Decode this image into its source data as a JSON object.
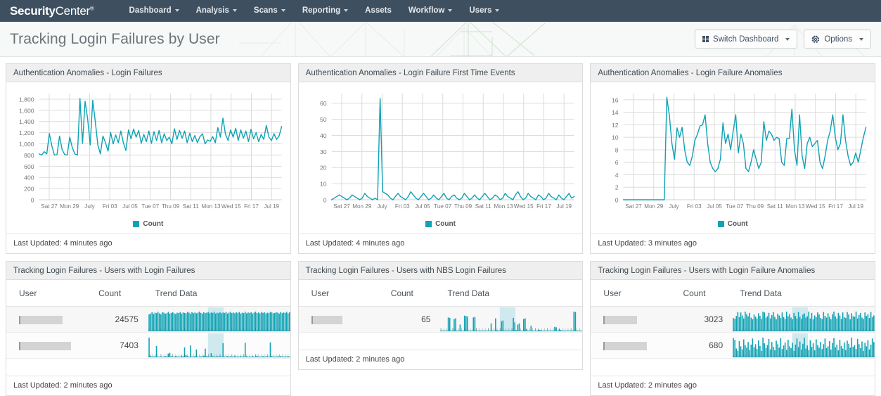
{
  "navbar": {
    "brand_bold": "Security",
    "brand_light": "Center",
    "brand_tm": "®",
    "items": [
      {
        "label": "Dashboard",
        "caret": true,
        "name": "nav-dashboard"
      },
      {
        "label": "Analysis",
        "caret": true,
        "name": "nav-analysis"
      },
      {
        "label": "Scans",
        "caret": true,
        "name": "nav-scans"
      },
      {
        "label": "Reporting",
        "caret": true,
        "name": "nav-reporting"
      },
      {
        "label": "Assets",
        "caret": false,
        "name": "nav-assets"
      },
      {
        "label": "Workflow",
        "caret": true,
        "name": "nav-workflow"
      },
      {
        "label": "Users",
        "caret": true,
        "name": "nav-users"
      }
    ]
  },
  "header": {
    "title": "Tracking Login Failures by User",
    "switch_dashboard_label": "Switch Dashboard",
    "options_label": "Options",
    "gear_icon": "gear-icon",
    "grid_icon": "grid-icon"
  },
  "colors": {
    "navbar": "#3e4f60",
    "teal": "#10a3b5",
    "teal_dark": "#0d92a4",
    "highlight": "#cfe9ef",
    "panel_head": "#efefef",
    "page_header": "#f7f8f8",
    "watermark_green": "#cfe3cb"
  },
  "legend_label": "Count",
  "table_headers": {
    "user": "User",
    "count": "Count",
    "trend": "Trend Data"
  },
  "panels": [
    {
      "name": "panel-login-failures",
      "title": "Authentication Anomalies - Login Failures",
      "footer": "Last Updated: 4 minutes ago"
    },
    {
      "name": "panel-login-failure-first-time-events",
      "title": "Authentication Anomalies - Login Failure First Time Events",
      "footer": "Last Updated: 4 minutes ago"
    },
    {
      "name": "panel-login-failure-anomalies",
      "title": "Authentication Anomalies - Login Failure Anomalies",
      "footer": "Last Updated: 3 minutes ago"
    },
    {
      "name": "panel-users-with-login-failures",
      "title": "Tracking Login Failures - Users with Login Failures",
      "footer": "Last Updated: 2 minutes ago",
      "rows": [
        {
          "user": "",
          "user_redacted": true,
          "redact_width": 62,
          "count": "24575"
        },
        {
          "user": "",
          "user_redacted": true,
          "redact_width": 74,
          "count": "7403"
        }
      ]
    },
    {
      "name": "panel-users-with-nbs-login-failures",
      "title": "Tracking Login Failures - Users with NBS Login Failures",
      "footer": "Last Updated: 2 minutes ago",
      "rows": [
        {
          "user": "",
          "user_redacted": true,
          "redact_width": 44,
          "count": "65"
        }
      ]
    },
    {
      "name": "panel-users-with-login-failure-anomalies",
      "title": "Tracking Login Failures - Users with Login Failure Anomalies",
      "footer": "Last Updated: 2 minutes ago",
      "rows": [
        {
          "user": "",
          "user_redacted": true,
          "redact_width": 48,
          "count": "3023"
        },
        {
          "user": "",
          "user_redacted": true,
          "redact_width": 62,
          "count": "680"
        }
      ]
    }
  ],
  "chart_data": [
    {
      "type": "line",
      "name": "chart-login-failures",
      "title": "Authentication Anomalies - Login Failures",
      "xlabel": "",
      "ylabel": "",
      "ylim": [
        0,
        1900
      ],
      "yticks": [
        0,
        200,
        400,
        600,
        800,
        1000,
        1200,
        1400,
        1600,
        1800
      ],
      "ytick_labels": [
        "0",
        "200",
        "400",
        "600",
        "800",
        "1,000",
        "1,200",
        "1,400",
        "1,600",
        "1,800"
      ],
      "xticks": [
        "Sat 27",
        "Mon 29",
        "July",
        "Fri 03",
        "Jul 05",
        "Tue 07",
        "Thu 09",
        "Sat 11",
        "Mon 13",
        "Wed 15",
        "Fri 17",
        "Jul 19"
      ],
      "grid": true,
      "legend": [
        "Count"
      ],
      "legend_position": "bottom",
      "series": [
        {
          "name": "Count",
          "color": "#10a3b5",
          "values": [
            820,
            800,
            860,
            820,
            1185,
            960,
            800,
            805,
            1140,
            900,
            810,
            800,
            1120,
            930,
            820,
            800,
            1810,
            1010,
            1760,
            1450,
            980,
            1780,
            1400,
            980,
            820,
            1140,
            1020,
            870,
            1205,
            1000,
            1160,
            1020,
            1230,
            1020,
            880,
            1250,
            1090,
            1265,
            1120,
            1240,
            1010,
            1170,
            1040,
            1230,
            1010,
            1220,
            1060,
            1240,
            1020,
            1180,
            1060,
            1120,
            1000,
            1270,
            1080,
            1240,
            1100,
            1230,
            1020,
            1190,
            1040,
            1150,
            1020,
            1130,
            1180,
            1000,
            1070,
            1045,
            1130,
            1020,
            1290,
            1120,
            1460,
            1170,
            1060,
            1250,
            1120,
            1280,
            1060,
            1250,
            1100,
            1230,
            1040,
            1260,
            1090,
            1200,
            1040,
            1170,
            1080,
            1330,
            1120,
            1060,
            1180,
            1080,
            1140,
            1310
          ]
        }
      ]
    },
    {
      "type": "line",
      "name": "chart-login-failure-first-time-events",
      "title": "Authentication Anomalies - Login Failure First Time Events",
      "xlabel": "",
      "ylabel": "",
      "ylim": [
        0,
        66
      ],
      "yticks": [
        0,
        10,
        20,
        30,
        40,
        50,
        60
      ],
      "ytick_labels": [
        "0",
        "10",
        "20",
        "30",
        "40",
        "50",
        "60"
      ],
      "xticks": [
        "Sat 27",
        "Mon 29",
        "July",
        "Fri 03",
        "Jul 05",
        "Tue 07",
        "Thu 09",
        "Sat 11",
        "Mon 13",
        "Wed 15",
        "Fri 17",
        "Jul 19"
      ],
      "grid": true,
      "legend": [
        "Count"
      ],
      "legend_position": "bottom",
      "series": [
        {
          "name": "Count",
          "color": "#10a3b5",
          "values": [
            0,
            1,
            2,
            3,
            2,
            1,
            0,
            1,
            3,
            2,
            1,
            0,
            1,
            4,
            2,
            1,
            0,
            1,
            0,
            63,
            5,
            4,
            3,
            1,
            0,
            2,
            4,
            2,
            1,
            0,
            2,
            5,
            3,
            1,
            0,
            2,
            4,
            2,
            0,
            1,
            3,
            1,
            0,
            2,
            4,
            1,
            0,
            2,
            3,
            1,
            0,
            1,
            4,
            2,
            0,
            1,
            3,
            1,
            0,
            2,
            4,
            2,
            0,
            1,
            3,
            2,
            0,
            1,
            4,
            2,
            1,
            0,
            3,
            5,
            2,
            0,
            1,
            4,
            2,
            1,
            0,
            3,
            2,
            0,
            1,
            4,
            2,
            1,
            0,
            3,
            1,
            0,
            2,
            4,
            1,
            2
          ]
        }
      ]
    },
    {
      "type": "line",
      "name": "chart-login-failure-anomalies",
      "title": "Authentication Anomalies - Login Failure Anomalies",
      "xlabel": "",
      "ylabel": "",
      "ylim": [
        0,
        17
      ],
      "yticks": [
        0,
        2,
        4,
        6,
        8,
        10,
        12,
        14,
        16
      ],
      "ytick_labels": [
        "0",
        "2",
        "4",
        "6",
        "8",
        "10",
        "12",
        "14",
        "16"
      ],
      "xticks": [
        "Sat 27",
        "Mon 29",
        "July",
        "Fri 03",
        "Jul 05",
        "Tue 07",
        "Thu 09",
        "Sat 11",
        "Mon 13",
        "Wed 15",
        "Fri 17",
        "Jul 19"
      ],
      "grid": true,
      "legend": [
        "Count"
      ],
      "legend_position": "bottom",
      "series": [
        {
          "name": "Count",
          "color": "#10a3b5",
          "values": [
            0,
            0,
            0,
            0,
            0,
            0,
            0,
            0,
            0,
            0,
            0,
            0,
            0,
            0,
            0,
            0,
            0,
            16.4,
            13.5,
            9,
            6.5,
            11.5,
            10,
            11.6,
            8,
            6,
            5.5,
            7,
            9.5,
            10.5,
            11.8,
            12,
            13.6,
            9,
            6,
            5,
            4.5,
            5,
            6.5,
            12.3,
            9,
            10.5,
            8,
            11,
            13.6,
            7.5,
            10.5,
            9,
            5,
            4.5,
            6,
            8,
            6.5,
            5,
            6,
            12.5,
            9.5,
            11,
            10.5,
            9.5,
            10,
            9.8,
            6,
            5.5,
            9.8,
            9.8,
            14.5,
            8,
            5.5,
            13.6,
            7,
            5,
            9,
            10,
            8.5,
            9,
            9.5,
            6,
            5,
            7,
            9.5,
            11,
            13.6,
            10,
            8,
            9,
            13.6,
            9.5,
            7,
            5.5,
            6,
            7.5,
            6,
            8,
            10,
            11.6
          ]
        }
      ]
    },
    {
      "type": "bar",
      "name": "sparkline-users-with-login-failures-row-1",
      "title": "Trend Data",
      "highlight_band": [
        0.42,
        0.53
      ],
      "values": [
        78,
        82,
        88,
        80,
        86,
        84,
        90,
        83,
        79,
        88,
        86,
        81,
        84,
        90,
        82,
        85,
        88,
        83,
        80,
        86,
        84,
        89,
        82,
        87,
        85,
        83,
        90,
        86,
        81,
        88,
        84,
        87,
        83,
        86,
        91,
        85,
        82,
        88,
        84,
        86,
        89,
        83,
        87,
        85,
        90,
        82,
        86,
        84,
        88,
        83,
        87,
        85,
        89,
        82,
        86,
        90,
        84,
        87,
        83,
        88,
        85,
        89,
        82,
        86,
        84,
        90,
        83,
        87,
        85,
        88,
        82,
        86,
        91,
        84,
        87,
        83,
        89,
        85,
        88,
        82,
        86,
        84,
        90,
        87,
        83,
        85,
        88,
        86,
        82,
        89,
        84,
        87,
        85,
        90,
        83,
        88
      ]
    },
    {
      "type": "bar",
      "name": "sparkline-users-with-login-failures-row-2",
      "title": "Trend Data",
      "highlight_band": [
        0.42,
        0.53
      ],
      "values": [
        95,
        8,
        4,
        2,
        6,
        55,
        3,
        2,
        4,
        3,
        2,
        6,
        4,
        18,
        22,
        5,
        3,
        2,
        7,
        4,
        2,
        3,
        8,
        5,
        48,
        10,
        6,
        3,
        58,
        4,
        2,
        6,
        38,
        3,
        2,
        5,
        4,
        8,
        42,
        6,
        3,
        2,
        20,
        5,
        4,
        3,
        6,
        2,
        5,
        3,
        68,
        4,
        2,
        6,
        3,
        5,
        2,
        4,
        8,
        3,
        5,
        2,
        6,
        4,
        3,
        70,
        5,
        2,
        4,
        3,
        6,
        2,
        5,
        8,
        3,
        4,
        2,
        6,
        3,
        5,
        4,
        2,
        72,
        6,
        3,
        4,
        2,
        5,
        3,
        6,
        4,
        2,
        5,
        3,
        6,
        4
      ]
    },
    {
      "type": "bar",
      "name": "sparkline-users-with-nbs-login-failures-row-1",
      "title": "Trend Data",
      "highlight_band": [
        0.42,
        0.53
      ],
      "values": [
        0,
        0,
        0,
        0,
        0,
        62,
        60,
        2,
        0,
        55,
        58,
        0,
        3,
        30,
        0,
        0,
        70,
        68,
        66,
        2,
        0,
        0,
        62,
        64,
        0,
        0,
        2,
        2,
        2,
        2,
        2,
        0,
        0,
        0,
        35,
        3,
        0,
        58,
        5,
        2,
        0,
        45,
        48,
        3,
        2,
        0,
        0,
        0,
        0,
        60,
        40,
        5,
        30,
        35,
        3,
        2,
        55,
        58,
        10,
        0,
        0,
        25,
        3,
        0,
        2,
        0,
        8,
        6,
        4,
        0,
        0,
        0,
        0,
        0,
        0,
        0,
        0,
        20,
        18,
        0,
        8,
        6,
        0,
        0,
        0,
        0,
        0,
        0,
        0,
        0,
        88,
        86,
        0,
        0,
        0,
        0
      ]
    },
    {
      "type": "bar",
      "name": "sparkline-users-with-login-failure-anomalies-row-1",
      "title": "Trend Data",
      "highlight_band": [
        0.42,
        0.53
      ],
      "values": [
        62,
        58,
        72,
        90,
        66,
        88,
        74,
        60,
        92,
        80,
        70,
        86,
        64,
        56,
        78,
        68,
        60,
        84,
        72,
        58,
        92,
        88,
        64,
        70,
        86,
        60,
        76,
        90,
        68,
        56,
        82,
        74,
        62,
        88,
        66,
        58,
        92,
        70,
        80,
        64,
        56,
        86,
        72,
        60,
        90,
        68,
        58,
        78,
        84,
        64,
        70,
        92,
        60,
        86,
        56,
        74,
        66,
        88,
        78,
        62,
        58,
        90,
        72,
        64,
        84,
        68,
        56,
        80,
        92,
        70,
        60,
        86,
        74,
        58,
        88,
        66,
        62,
        90,
        78,
        56,
        84,
        70,
        68,
        92,
        60,
        76,
        86,
        64,
        58,
        88,
        72,
        80,
        62,
        90,
        66,
        74
      ]
    },
    {
      "type": "bar",
      "name": "sparkline-users-with-login-failure-anomalies-row-2",
      "title": "Trend Data",
      "highlight_band": [
        0.42,
        0.53
      ],
      "values": [
        88,
        80,
        40,
        30,
        74,
        50,
        36,
        82,
        56,
        44,
        70,
        34,
        58,
        86,
        46,
        60,
        38,
        78,
        52,
        30,
        90,
        64,
        42,
        56,
        84,
        36,
        70,
        48,
        32,
        76,
        60,
        44,
        88,
        38,
        54,
        68,
        34,
        80,
        50,
        42,
        66,
        30,
        58,
        86,
        46,
        72,
        36,
        62,
        90,
        40,
        54,
        34,
        78,
        48,
        64,
        32,
        82,
        56,
        44,
        70,
        38,
        60,
        86,
        42,
        50,
        74,
        36,
        66,
        88,
        46,
        58,
        32,
        80,
        52,
        40,
        68,
        34,
        76,
        62,
        44,
        90,
        48,
        56,
        38,
        84,
        60,
        42,
        72,
        30,
        66,
        50,
        78,
        36,
        58,
        86,
        70
      ]
    }
  ]
}
